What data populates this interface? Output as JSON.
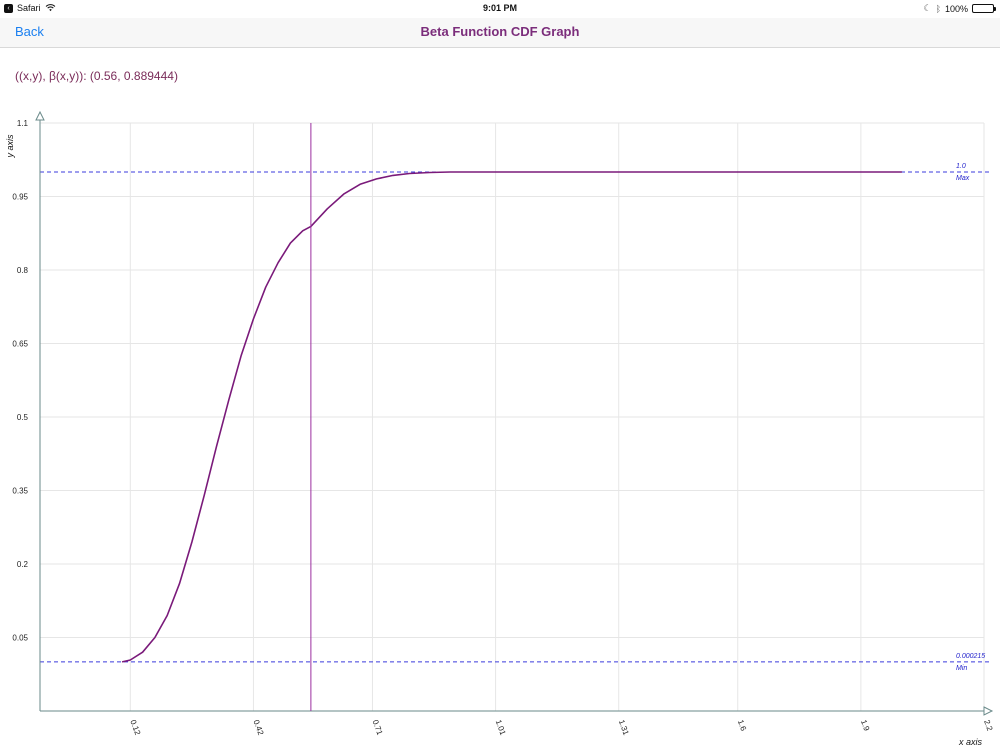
{
  "status": {
    "app": "Safari",
    "time": "9:01 PM",
    "battery": "100%"
  },
  "nav": {
    "back_label": "Back",
    "title": "Beta Function CDF Graph"
  },
  "readout": "((x,y), β(x,y)): (0.56, 0.889444)",
  "colors": {
    "curve": "#7a1a7a",
    "cursor": "#9b2fa0",
    "reference": "#3b3bdc",
    "grid": "#e6e6e6",
    "axis": "#6a8a8a",
    "nav_tint": "#1a7ff0",
    "title": "#7b2d7b"
  },
  "chart_data": {
    "type": "line",
    "xlabel": "x axis",
    "ylabel": "y axis",
    "xlim": [
      -0.1,
      2.2
    ],
    "ylim": [
      -0.1,
      1.1
    ],
    "x_ticks": [
      "0.12",
      "0.42",
      "0.71",
      "1.01",
      "1.31",
      "1.6",
      "1.9",
      "2.2"
    ],
    "x_tick_values": [
      0.12,
      0.42,
      0.71,
      1.01,
      1.31,
      1.6,
      1.9,
      2.2
    ],
    "y_ticks": [
      "0.05",
      "0.2",
      "0.35",
      "0.5",
      "0.65",
      "0.8",
      "0.95",
      "1.1"
    ],
    "y_tick_values": [
      0.05,
      0.2,
      0.35,
      0.5,
      0.65,
      0.8,
      0.95,
      1.1
    ],
    "grid": true,
    "cursor_x": 0.56,
    "reference_lines": [
      {
        "y": 1.0,
        "value_label": "1.0",
        "name": "Max"
      },
      {
        "y": 0.000215,
        "value_label": "0.000215",
        "name": "Min"
      }
    ],
    "series": [
      {
        "x": [
          0.1,
          0.12,
          0.15,
          0.18,
          0.21,
          0.24,
          0.27,
          0.3,
          0.33,
          0.36,
          0.39,
          0.42,
          0.45,
          0.48,
          0.51,
          0.54,
          0.56,
          0.6,
          0.64,
          0.68,
          0.72,
          0.76,
          0.8,
          0.85,
          0.9,
          1.0,
          1.2,
          1.5,
          1.8,
          2.0
        ],
        "y": [
          0.0002,
          0.004,
          0.02,
          0.05,
          0.095,
          0.16,
          0.245,
          0.34,
          0.44,
          0.535,
          0.625,
          0.7,
          0.765,
          0.815,
          0.855,
          0.88,
          0.889,
          0.925,
          0.955,
          0.975,
          0.986,
          0.993,
          0.997,
          0.999,
          1.0,
          1.0,
          1.0,
          1.0,
          1.0,
          1.0
        ]
      }
    ]
  }
}
